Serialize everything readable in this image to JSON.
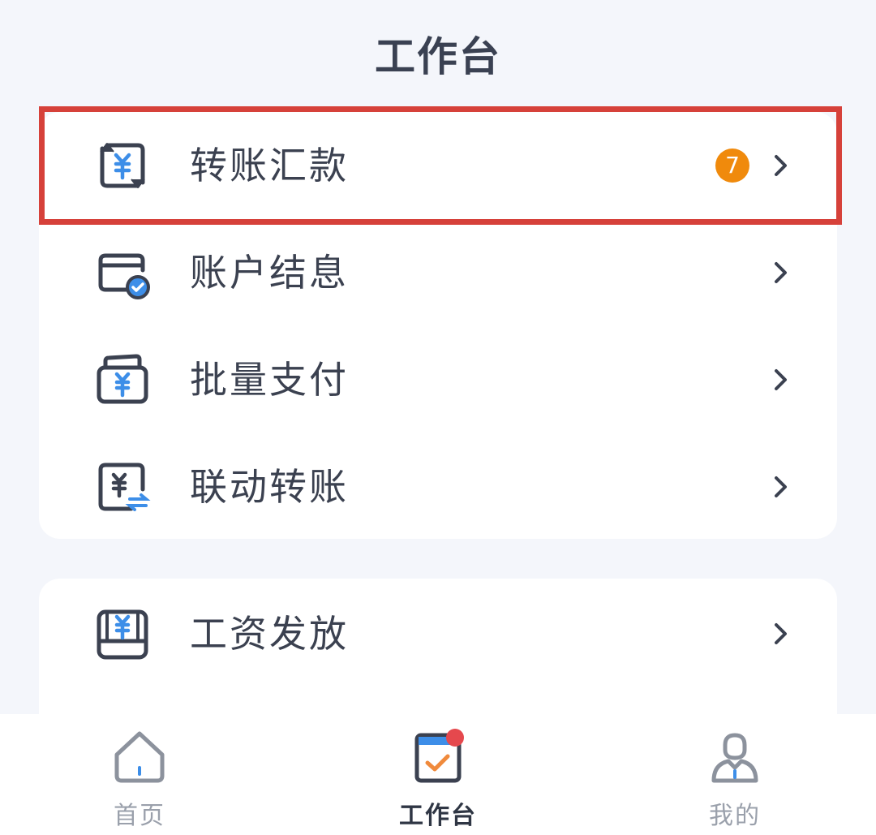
{
  "header": {
    "title": "工作台"
  },
  "menu": {
    "items": [
      {
        "label": "转账汇款",
        "icon": "transfer-icon",
        "badge": "7"
      },
      {
        "label": "账户结息",
        "icon": "account-interest-icon"
      },
      {
        "label": "批量支付",
        "icon": "batch-payment-icon"
      },
      {
        "label": "联动转账",
        "icon": "linked-transfer-icon"
      }
    ]
  },
  "menu2": {
    "items": [
      {
        "label": "工资发放",
        "icon": "payroll-icon"
      }
    ]
  },
  "tabbar": {
    "tabs": [
      {
        "label": "首页",
        "icon": "home-icon"
      },
      {
        "label": "工作台",
        "icon": "workbench-icon",
        "active": true,
        "dot": true
      },
      {
        "label": "我的",
        "icon": "profile-icon"
      }
    ]
  },
  "colors": {
    "background": "#f4f6fb",
    "card": "#ffffff",
    "text": "#3b4150",
    "accent_blue": "#3d8ee8",
    "badge_orange": "#f08a0c",
    "highlight_red": "#d6413a",
    "dot_red": "#e5484d"
  }
}
